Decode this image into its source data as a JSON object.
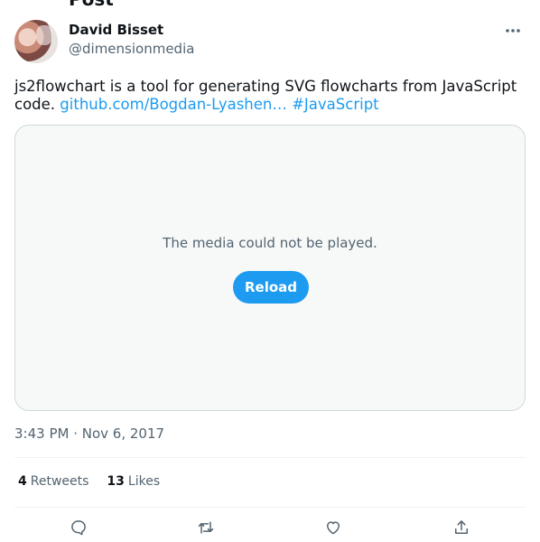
{
  "header": {
    "title_partial": "Post"
  },
  "author": {
    "name": "David Bisset",
    "handle": "@dimensionmedia"
  },
  "tweet": {
    "text": "js2flowchart is a tool for generating SVG flowcharts from JavaScript code. ",
    "link_label": "github.com/Bogdan-Lyashen…",
    "hashtag": "#JavaScript"
  },
  "media": {
    "error_message": "The media could not be played.",
    "reload_label": "Reload"
  },
  "timestamp": "3:43 PM · Nov 6, 2017",
  "stats": {
    "retweets_count": "4",
    "retweets_label": "Retweets",
    "likes_count": "13",
    "likes_label": "Likes"
  },
  "icons": {
    "more": "more-icon",
    "reply": "reply-icon",
    "retweet": "retweet-icon",
    "like": "like-icon",
    "share": "share-icon"
  },
  "colors": {
    "accent": "#1d9bf0",
    "text": "#0f1419",
    "muted": "#536471",
    "border": "#cfd9de"
  }
}
